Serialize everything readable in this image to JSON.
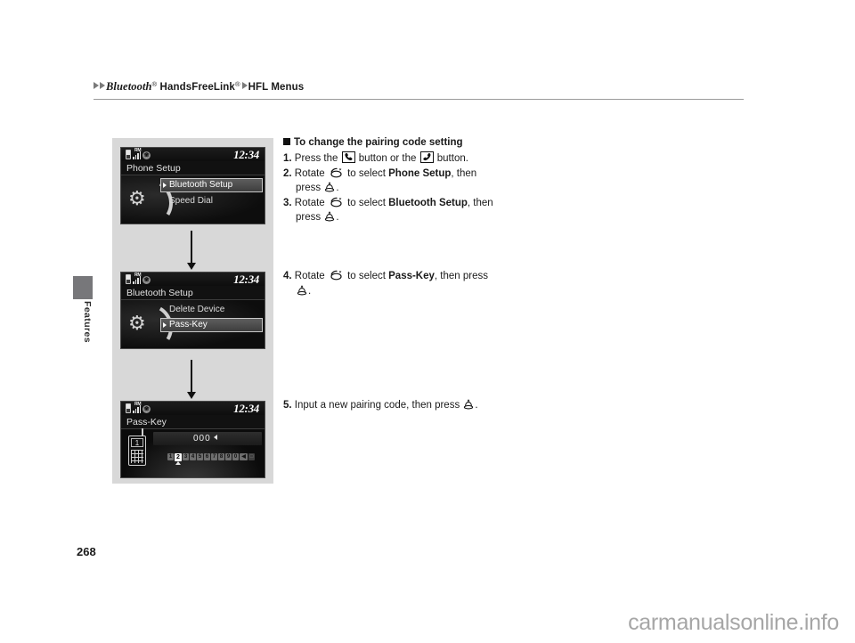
{
  "breadcrumb": {
    "product": "Bluetooth",
    "feature": "HandsFreeLink",
    "section": "HFL Menus",
    "registered_mark": "®"
  },
  "side_tab": {
    "label": "Features"
  },
  "page": {
    "number": "268",
    "watermark": "carmanualsonline.info"
  },
  "instructions": {
    "heading": "To change the pairing code setting",
    "steps": [
      {
        "num": "1.",
        "text_before": "Press the",
        "icon_1": "phone-call-button-icon",
        "text_middle": "button or the",
        "icon_2": "phone-hangup-button-icon",
        "text_after": "button."
      },
      {
        "num": "2.",
        "text_before": "Rotate",
        "icon_1": "rotate-knob-icon",
        "text_middle": "to select",
        "target": "Phone Setup",
        "text_after": ", then",
        "cont_before": "press",
        "icon_2": "press-knob-icon",
        "cont_after": "."
      },
      {
        "num": "3.",
        "text_before": "Rotate",
        "icon_1": "rotate-knob-icon",
        "text_middle": "to select",
        "target": "Bluetooth Setup",
        "text_after": ", then",
        "cont_before": "press",
        "icon_2": "press-knob-icon",
        "cont_after": "."
      },
      {
        "num": "4.",
        "text_before": "Rotate",
        "icon_1": "rotate-knob-icon",
        "text_middle": "to select",
        "target": "Pass-Key",
        "text_after": ", then press",
        "icon_2": "press-knob-icon",
        "cont_after": "."
      },
      {
        "num": "5.",
        "text_before": "Input a new pairing code, then press",
        "icon_2": "press-knob-icon",
        "cont_after": "."
      }
    ]
  },
  "screens": [
    {
      "id": "phone-setup",
      "clock": "12:34",
      "roaming": "RM",
      "title": "Phone Setup",
      "icon": "gear-icon",
      "menu": [
        {
          "label": "Bluetooth Setup",
          "selected": true
        },
        {
          "label": "Speed Dial",
          "selected": false
        }
      ]
    },
    {
      "id": "bluetooth-setup",
      "clock": "12:34",
      "roaming": "RM",
      "title": "Bluetooth Setup",
      "icon": "gear-icon",
      "menu": [
        {
          "label": "Delete Device",
          "selected": false
        },
        {
          "label": "Pass-Key",
          "selected": true
        }
      ]
    },
    {
      "id": "pass-key",
      "clock": "12:34",
      "roaming": "RM",
      "title": "Pass-Key",
      "icon": "cellphone-icon",
      "phone_screen_digit": "1",
      "input_value": "000",
      "keypad": [
        "1",
        "2",
        "3",
        "4",
        "5",
        "6",
        "7",
        "8",
        "9",
        "0"
      ],
      "keypad_selected": "2",
      "keypad_extra": [
        "backspace-key",
        "enter-key"
      ]
    }
  ]
}
